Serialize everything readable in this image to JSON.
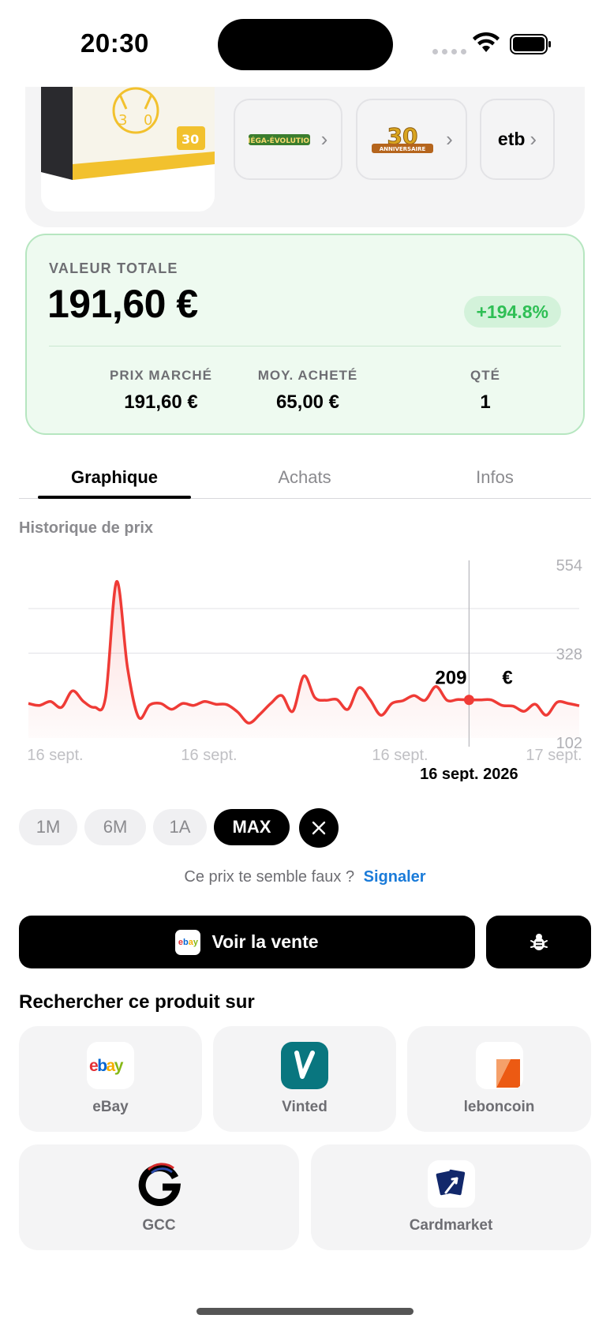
{
  "status_bar": {
    "time": "20:30"
  },
  "product": {
    "tags": [
      {
        "name": "mega-evolution-logo",
        "text": "MÉGA-ÉVOLUTION"
      },
      {
        "name": "30-anniversaire-logo",
        "text": "30 ANNIVERSAIRE"
      },
      {
        "name": "etb",
        "text": "etb"
      }
    ],
    "box_caption": "30 ANNIVERSAIRE"
  },
  "value_card": {
    "label": "VALEUR TOTALE",
    "amount": "191,60 €",
    "change": "+194.8%",
    "stats": [
      {
        "label": "PRIX MARCHÉ",
        "value": "191,60 €"
      },
      {
        "label": "MOY. ACHETÉ",
        "value": "65,00 €"
      },
      {
        "label": "QTÉ",
        "value": "1"
      }
    ],
    "colors": {
      "positive": "#2fbf55",
      "card_bg": "#eefaf0"
    }
  },
  "tabs": [
    "Graphique",
    "Achats",
    "Infos"
  ],
  "active_tab": "Graphique",
  "history_label": "Historique de prix",
  "chart_data": {
    "type": "line",
    "y_ticks": [
      "554",
      "328",
      "102"
    ],
    "x_ticks": [
      "16 sept.",
      "16 sept.",
      "16 sept.",
      "17 sept."
    ],
    "ylim": [
      102,
      554
    ],
    "grid": true,
    "series": [
      {
        "color": "#ef3b36",
        "values": [
          200,
          195,
          205,
          190,
          232,
          205,
          190,
          215,
          510,
          290,
          165,
          196,
          200,
          185,
          200,
          195,
          205,
          198,
          197,
          178,
          150,
          172,
          200,
          220,
          180,
          270,
          215,
          208,
          210,
          185,
          240,
          210,
          170,
          200,
          207,
          220,
          208,
          243,
          208,
          210,
          209,
          209,
          209,
          195,
          193,
          180,
          198,
          170,
          203,
          200,
          194
        ]
      }
    ],
    "selected": {
      "value": "209",
      "unit": "€",
      "date": "16 sept. 2026"
    }
  },
  "periods": [
    "1M",
    "6M",
    "1A",
    "MAX"
  ],
  "active_period": "MAX",
  "report": {
    "question": "Ce prix te semble faux ?",
    "link": "Signaler"
  },
  "actions": {
    "view_sale": "Voir la vente",
    "ebay_mini": "ebay"
  },
  "search_section": {
    "title": "Rechercher ce produit sur",
    "stores": [
      "eBay",
      "Vinted",
      "leboncoin",
      "GCC",
      "Cardmarket"
    ]
  }
}
